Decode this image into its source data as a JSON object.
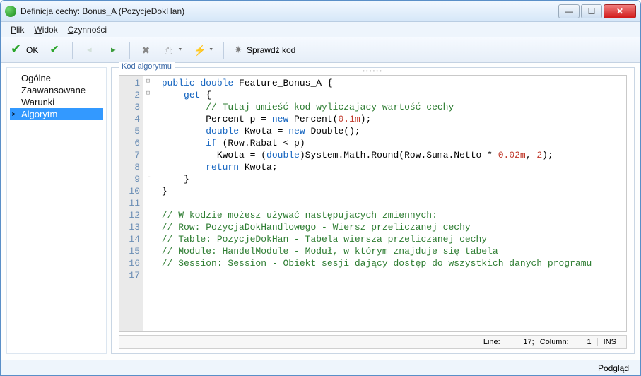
{
  "window": {
    "title": "Definicja cechy: Bonus_A (PozycjeDokHan)"
  },
  "menu": {
    "plik": "Plik",
    "widok": "Widok",
    "czynnosci": "Czynności"
  },
  "toolbar": {
    "ok": "OK",
    "sprawdz": "Sprawdź kod"
  },
  "sidebar": {
    "items": [
      {
        "label": "Ogólne"
      },
      {
        "label": "Zaawansowane"
      },
      {
        "label": "Warunki"
      },
      {
        "label": "Algorytm"
      }
    ]
  },
  "editor": {
    "group_label": "Kod algorytmu",
    "status": {
      "line_label": "Line:",
      "line": "17;",
      "col_label": "Column:",
      "col": "1",
      "mode": "INS"
    },
    "line_count": 17
  },
  "bottom": {
    "podglad": "Podgląd"
  },
  "code": {
    "l1_a": "public",
    "l1_b": "double",
    "l1_c": " Feature_Bonus_A {",
    "l2_a": "get",
    "l2_b": " {",
    "l3": "// Tutaj umieść kod wyliczajacy wartość cechy",
    "l4_a": "Percent p = ",
    "l4_b": "new",
    "l4_c": " Percent(",
    "l4_d": "0.1m",
    "l4_e": ");",
    "l5_a": "double",
    "l5_b": " Kwota = ",
    "l5_c": "new",
    "l5_d": " Double();",
    "l6_a": "if",
    "l6_b": " (Row.Rabat < p)",
    "l7_a": "Kwota = (",
    "l7_b": "double",
    "l7_c": ")System.Math.Round(Row.Suma.Netto * ",
    "l7_d": "0.02m",
    "l7_e": ", ",
    "l7_f": "2",
    "l7_g": ");",
    "l8_a": "return",
    "l8_b": " Kwota;",
    "l9": "}",
    "l10": "}",
    "l12": "// W kodzie możesz używać następujacych zmiennych:",
    "l13": "// Row: PozycjaDokHandlowego - Wiersz przeliczanej cechy",
    "l14": "// Table: PozycjeDokHan - Tabela wiersza przeliczanej cechy",
    "l15": "// Module: HandelModule - Moduł, w którym znajduje się tabela",
    "l16": "// Session: Session - Obiekt sesji dający dostęp do wszystkich danych programu"
  }
}
